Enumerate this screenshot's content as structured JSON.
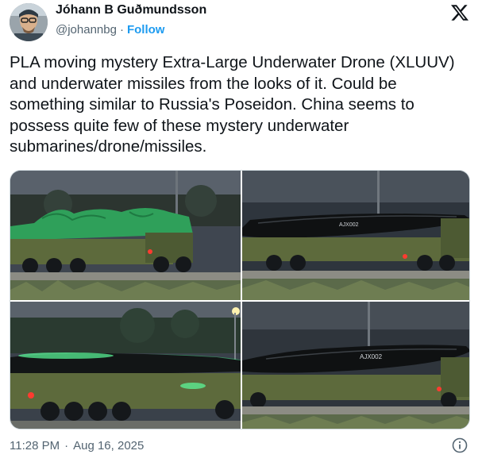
{
  "author": {
    "name": "Jóhann B Guðmundsson",
    "handle": "@johannbg",
    "follow_label": "Follow",
    "separator": "·"
  },
  "tweet": {
    "text": "PLA moving mystery Extra-Large Underwater Drone (XLUUV) and underwater missiles from the looks of it. Could be something similar to Russia's Poseidon. China seems to possess quite few of these mystery underwater submarines/drone/missiles."
  },
  "media": {
    "photos": [
      {
        "name": "covered-drone-photo"
      },
      {
        "name": "black-drone-photo-1",
        "hull_text": "AJX002"
      },
      {
        "name": "green-lit-drone-photo"
      },
      {
        "name": "black-drone-photo-2",
        "hull_text": "AJX002"
      }
    ]
  },
  "meta": {
    "time": "11:28 PM",
    "separator": "·",
    "date": "Aug 16, 2025"
  },
  "icons": {
    "brand": "x-logo-icon",
    "info": "info-icon"
  },
  "colors": {
    "follow": "#1d9bf0",
    "secondary_text": "#536471",
    "primary_text": "#0f1419"
  }
}
